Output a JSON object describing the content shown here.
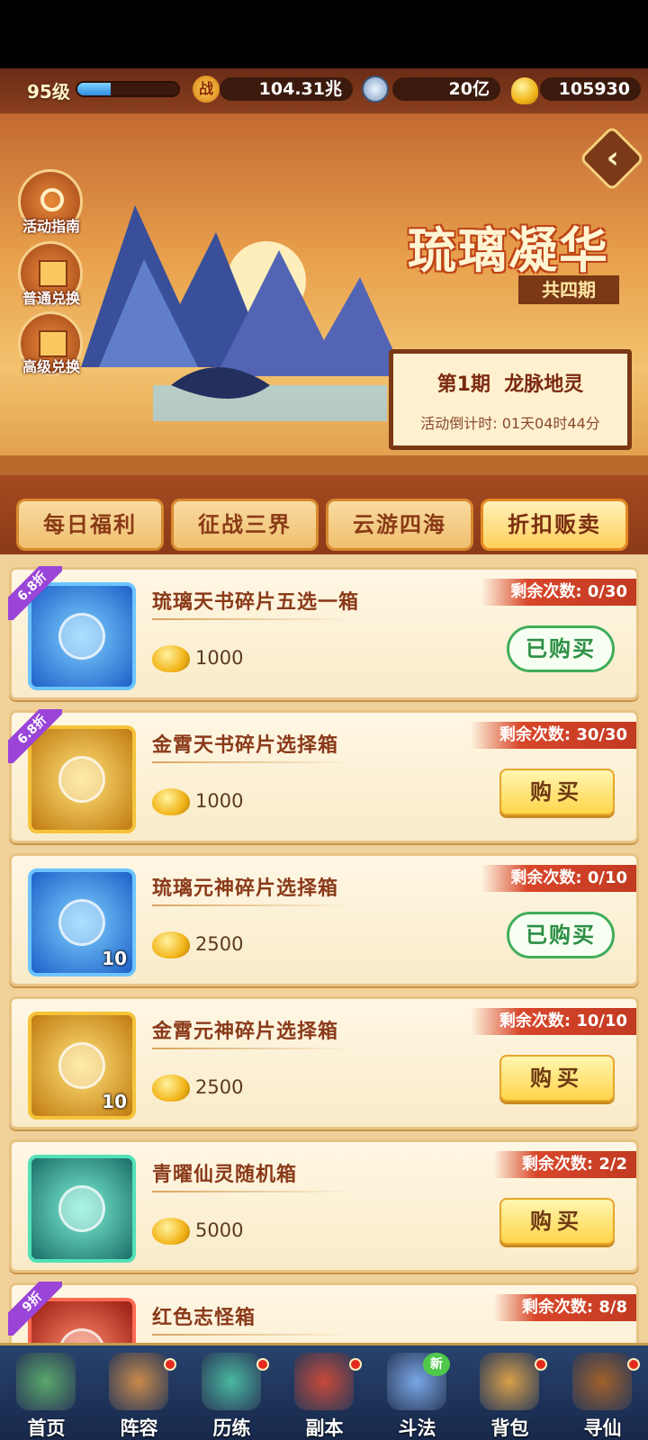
{
  "top": {
    "level": "95级",
    "xp_fraction": 0.33,
    "power": "104.31兆",
    "coins": "20亿",
    "gold": "105930",
    "power_icon": "战"
  },
  "side": [
    {
      "label": "活动指南",
      "icon": "magnifier-icon"
    },
    {
      "label": "普通兑换",
      "icon": "gift-box-icon"
    },
    {
      "label": "高级兑换",
      "icon": "gift-box-icon"
    }
  ],
  "banner": {
    "title": "琉璃凝华",
    "subtitle": "共四期",
    "period": "第1期  龙脉地灵",
    "countdown": "活动倒计时: 01天04时44分"
  },
  "tabs": [
    {
      "label": "每日福利"
    },
    {
      "label": "征战三界"
    },
    {
      "label": "云游四海"
    },
    {
      "label": "折扣贩卖",
      "active": true
    }
  ],
  "items": [
    {
      "name": "琉璃天书碎片五选一箱",
      "price": "1000",
      "remain": "剩余次数: 0/30",
      "discount": "6.8折",
      "status": "已购买",
      "thumb": "blue"
    },
    {
      "name": "金霄天书碎片选择箱",
      "price": "1000",
      "remain": "剩余次数: 30/30",
      "discount": "6.8折",
      "status": "购买",
      "thumb": "gold"
    },
    {
      "name": "琉璃元神碎片选择箱",
      "price": "2500",
      "remain": "剩余次数: 0/10",
      "status": "已购买",
      "qty": "10",
      "thumb": "blue"
    },
    {
      "name": "金霄元神碎片选择箱",
      "price": "2500",
      "remain": "剩余次数: 10/10",
      "status": "购买",
      "qty": "10",
      "thumb": "gold"
    },
    {
      "name": "青曜仙灵随机箱",
      "price": "5000",
      "remain": "剩余次数: 2/2",
      "status": "购买",
      "thumb": "teal"
    },
    {
      "name": "红色志怪箱",
      "price": "",
      "remain": "剩余次数: 8/8",
      "discount": "9折",
      "status": "",
      "thumb": "red"
    }
  ],
  "nav": [
    {
      "label": "首页"
    },
    {
      "label": "阵容",
      "dot": true
    },
    {
      "label": "历练",
      "dot": true
    },
    {
      "label": "副本",
      "dot": true
    },
    {
      "label": "斗法",
      "new": "新"
    },
    {
      "label": "背包",
      "dot": true
    },
    {
      "label": "寻仙",
      "dot": true
    }
  ]
}
